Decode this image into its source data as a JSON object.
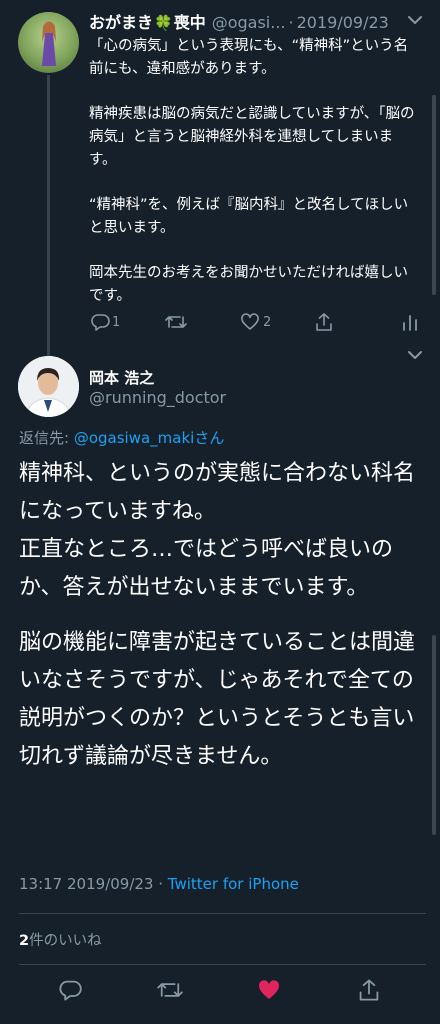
{
  "parent_tweet": {
    "name": "おがまき",
    "status_emoji": "🍀",
    "status_text": "喪中",
    "handle": "@ogasi...",
    "separator": "·",
    "date": "2019/09/23",
    "paragraphs": [
      "「心の病気」という表現にも、“精神科”という名前にも、違和感があります。",
      "精神疾患は脳の病気だと認識していますが、「脳の病気」と言うと脳神経外科を連想してしまいます。",
      "“精神科”を、例えば『脳内科』と改名してほしいと思います。",
      "岡本先生のお考えをお聞かせいただければ嬉しいです。"
    ],
    "reply_count": "1",
    "like_count": "2"
  },
  "main_tweet": {
    "name": "岡本 浩之",
    "handle": "@running_doctor",
    "reply_prefix": "返信先: ",
    "reply_to_handle": "@ogasiwa_maki",
    "reply_suffix": "さん",
    "paragraphs": [
      "精神科、というのが実態に合わない科名になっていますね。\n正直なところ…ではどう呼べば良いのか、答えが出せないままでいます。",
      "脳の機能に障害が起きていることは間違いなさそうですが、じゃあそれで全ての説明がつくのか？というとそうとも言い切れず議論が尽きません。"
    ],
    "time": "13:17",
    "date": "2019/09/23",
    "separator": " · ",
    "source": "Twitter for iPhone",
    "like_count": "2",
    "likes_label": "件のいいね"
  },
  "colors": {
    "background": "#15202b",
    "text": "#ffffff",
    "muted": "#8899a6",
    "accent": "#1da1f2",
    "like_active": "#e0245e",
    "divider": "#38444d"
  },
  "icons": [
    "reply-icon",
    "retweet-icon",
    "like-icon",
    "share-icon",
    "analytics-icon",
    "chevron-down-icon"
  ]
}
